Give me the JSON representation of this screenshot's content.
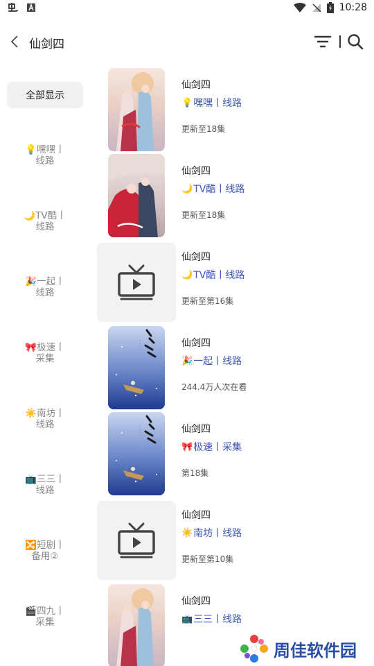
{
  "status_bar": {
    "time": "10:28"
  },
  "header": {
    "title": "仙剑四"
  },
  "sidebar": {
    "all_label": "全部显示",
    "items": [
      {
        "emoji": "💡",
        "label": "嘿嘿丨",
        "label2": "线路"
      },
      {
        "emoji": "🌙",
        "label": "TV酷丨",
        "label2": "线路"
      },
      {
        "emoji": "🎉",
        "label": "一起丨",
        "label2": "线路"
      },
      {
        "emoji": "🎀",
        "label": "极速丨",
        "label2": "采集"
      },
      {
        "emoji": "☀️",
        "label": "南坊丨",
        "label2": "线路"
      },
      {
        "emoji": "📺",
        "label": "三三丨",
        "label2": "线路"
      },
      {
        "emoji": "🔀",
        "label": "短剧丨",
        "label2": "备用②"
      },
      {
        "emoji": "🎬",
        "label": "四九丨",
        "label2": "采集"
      }
    ]
  },
  "results": [
    {
      "title": "仙剑四",
      "emoji": "💡",
      "source": "嘿嘿丨线路",
      "status": "更新至18集",
      "poster": "poster-a"
    },
    {
      "title": "仙剑四",
      "emoji": "🌙",
      "source": "TV酷丨线路",
      "status": "更新至18集",
      "poster": "poster-b"
    },
    {
      "title": "仙剑四",
      "emoji": "🌙",
      "source": "TV酷丨线路",
      "status": "更新至第16集",
      "poster": "tv-placeholder"
    },
    {
      "title": "仙剑四",
      "emoji": "🎉",
      "source": "一起丨线路",
      "status": "244.4万人次在看",
      "poster": "poster-c"
    },
    {
      "title": "仙剑四",
      "emoji": "🎀",
      "source": "极速丨采集",
      "status": "第18集",
      "poster": "poster-c"
    },
    {
      "title": "仙剑四",
      "emoji": "☀️",
      "source": "南坊丨线路",
      "status": "更新至第10集",
      "poster": "tv-placeholder"
    },
    {
      "title": "仙剑四",
      "emoji": "📺",
      "source": "三三丨线路",
      "status": "",
      "poster": "poster-a"
    }
  ],
  "watermark": {
    "text": "周佳软件园"
  },
  "colors": {
    "accent": "#3d55b8",
    "muted": "#888888"
  }
}
